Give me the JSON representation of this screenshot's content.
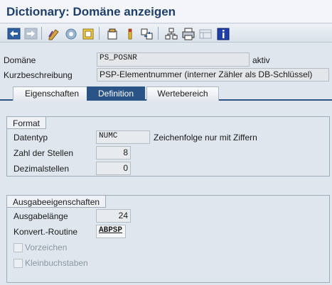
{
  "window": {
    "title": "Dictionary: Domäne anzeigen"
  },
  "toolbar": {
    "icons": [
      "back-arrow-icon",
      "forward-arrow-icon",
      "display-change-icon",
      "other-object-icon",
      "check-icon",
      "activate-icon",
      "where-used-icon",
      "object-list-icon",
      "navigation-icon",
      "hierarchy-icon",
      "print-icon",
      "layout-icon",
      "info-icon"
    ]
  },
  "header": {
    "domain_label": "Domäne",
    "domain_value": "PS_POSNR",
    "status": "aktiv",
    "short_desc_label": "Kurzbeschreibung",
    "short_desc_value": "PSP-Elementnummer (interner Zähler als DB-Schlüssel)"
  },
  "tabs": [
    {
      "label": "Eigenschaften",
      "active": false
    },
    {
      "label": "Definition",
      "active": true
    },
    {
      "label": "Wertebereich",
      "active": false
    }
  ],
  "format": {
    "title": "Format",
    "datatype_label": "Datentyp",
    "datatype_value": "NUMC",
    "datatype_desc": "Zeichenfolge nur mit Ziffern",
    "length_label": "Zahl der Stellen",
    "length_value": "8",
    "decimals_label": "Dezimalstellen",
    "decimals_value": "0"
  },
  "output": {
    "title": "Ausgabeeigenschaften",
    "outlen_label": "Ausgabelänge",
    "outlen_value": "24",
    "conv_label": "Konvert.-Routine",
    "conv_value": "ABPSP",
    "sign_label": "Vorzeichen",
    "sign_checked": false,
    "lowercase_label": "Kleinbuchstaben",
    "lowercase_checked": false
  },
  "colors": {
    "accent": "#2a5386",
    "title": "#1f3f6b",
    "background": "#dfe6ee"
  }
}
